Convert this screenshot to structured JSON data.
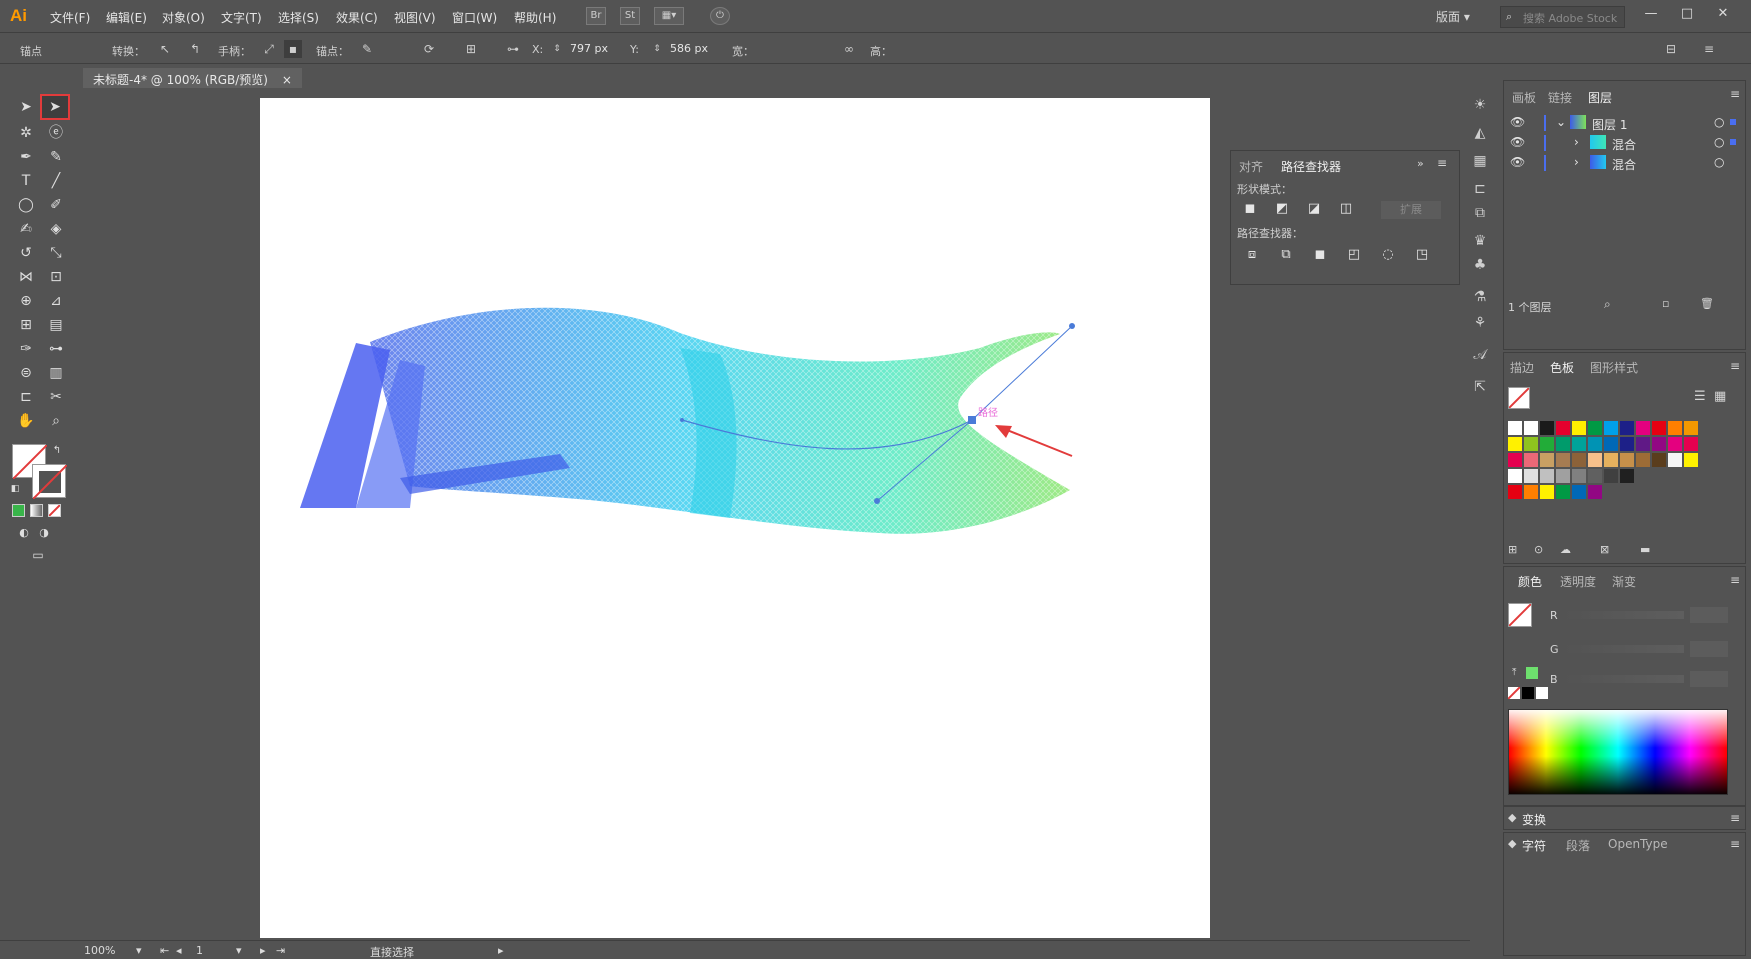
{
  "menubar": {
    "logo": "Ai",
    "items": [
      "文件(F)",
      "编辑(E)",
      "对象(O)",
      "文字(T)",
      "选择(S)",
      "效果(C)",
      "视图(V)",
      "窗口(W)",
      "帮助(H)"
    ],
    "bridge": "Br",
    "stock": "St",
    "workspace": "版面",
    "search_placeholder": "搜索 Adobe Stock",
    "min": "—",
    "restore": "□",
    "close": "✕"
  },
  "controlbar": {
    "anchor_label": "锚点",
    "convert_label": "转换：",
    "handle_label": "手柄：",
    "anchors_label": "锚点：",
    "x_label": "X:",
    "x_value": "797 px",
    "y_label": "Y:",
    "y_value": "586 px",
    "w_label": "宽：",
    "h_label": "高："
  },
  "document": {
    "tab_title": "未标题-4* @ 100% (RGB/预览)",
    "tab_close": "×"
  },
  "canvas": {
    "path_label": "路径"
  },
  "statusbar": {
    "zoom": "100%",
    "artboard_number": "1",
    "tool_name": "直接选择"
  },
  "pathfinder": {
    "tab_align": "对齐",
    "tab_pathfinder": "路径查找器",
    "shape_modes_label": "形状模式：",
    "expand_label": "扩展",
    "pathfinders_label": "路径查找器："
  },
  "layers_panel": {
    "tabs": [
      "画板",
      "链接",
      "图层"
    ],
    "active_tab": "图层",
    "layers": [
      {
        "name": "图层 1",
        "level": 0
      },
      {
        "name": "混合",
        "level": 1
      },
      {
        "name": "混合",
        "level": 1
      }
    ],
    "count": "1 个图层"
  },
  "swatches_panel": {
    "tabs": [
      "描边",
      "色板",
      "图形样式"
    ],
    "active_tab": "色板",
    "row1": [
      "#ffffff",
      "#ffffff",
      "#1a1a1a",
      "#e6002d",
      "#ffee00",
      "#009944",
      "#00a0e9",
      "#1d2088",
      "#e4007f",
      "#e60012",
      "#ff7f00",
      "#f39800"
    ],
    "row2": [
      "#fff100",
      "#8fc31f",
      "#22ac38",
      "#009b6b",
      "#00a29a",
      "#0093b4",
      "#0068b7",
      "#1d2088",
      "#601986",
      "#920783",
      "#e4007f",
      "#e5004f"
    ],
    "row3": [
      "#e5004f",
      "#eb6877",
      "#c9a063",
      "#a67c52",
      "#8c6239",
      "#f7c08a",
      "#e6b15e",
      "#c7904a",
      "#9d6c36",
      "#5a3d1d",
      "#f5f5f5",
      "#fff100"
    ],
    "row4": [
      "#ffffff",
      "#e0e0e0",
      "#c0c0c0",
      "#a0a0a0",
      "#808080",
      "#606060",
      "#404040",
      "#202020"
    ],
    "row5": [
      "#e60012",
      "#ff7f00",
      "#fff100",
      "#009944",
      "#0068b7",
      "#920783"
    ]
  },
  "color_panel": {
    "tabs": [
      "颜色",
      "透明度",
      "渐变"
    ],
    "active_tab": "颜色",
    "r_label": "R",
    "g_label": "G",
    "b_label": "B"
  },
  "transform_panel": {
    "title": "变换"
  },
  "character_panel": {
    "tabs": [
      "字符",
      "段落",
      "OpenType"
    ]
  },
  "colors": {
    "ui_bg": "#535353",
    "artboard": "#ffffff",
    "highlight": "#e23b3b"
  }
}
